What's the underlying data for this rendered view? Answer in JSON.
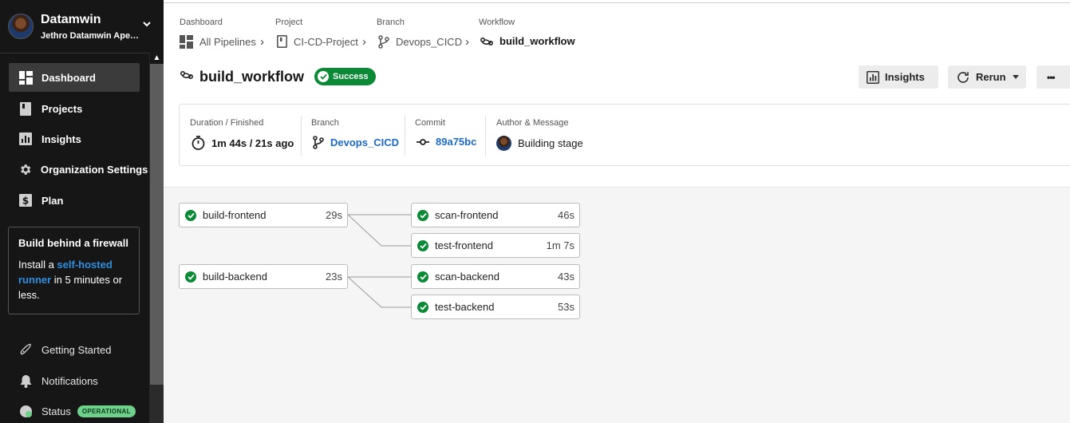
{
  "sidebar": {
    "org_name": "Datamwin",
    "user_name": "Jethro Datamwin Ape…",
    "nav": [
      {
        "label": "Dashboard",
        "icon": "dashboard-icon",
        "active": true
      },
      {
        "label": "Projects",
        "icon": "projects-icon",
        "active": false
      },
      {
        "label": "Insights",
        "icon": "insights-icon",
        "active": false
      },
      {
        "label": "Organization Settings",
        "icon": "gear-icon",
        "active": false
      },
      {
        "label": "Plan",
        "icon": "dollar-icon",
        "active": false
      }
    ],
    "firewall": {
      "title": "Build behind a firewall",
      "text_before": "Install a ",
      "link": "self-hosted runner",
      "text_after": " in 5 minutes or less."
    },
    "bottom": [
      {
        "label": "Getting Started",
        "icon": "rocket-icon"
      },
      {
        "label": "Notifications",
        "icon": "bell-icon"
      },
      {
        "label": "Status",
        "icon": "status-icon",
        "badge": "OPERATIONAL"
      }
    ]
  },
  "breadcrumb": [
    {
      "label": "Dashboard",
      "value": "All Pipelines",
      "icon": "pipelines-icon"
    },
    {
      "label": "Project",
      "value": "CI-CD-Project",
      "icon": "project-icon"
    },
    {
      "label": "Branch",
      "value": "Devops_CICD",
      "icon": "branch-icon"
    },
    {
      "label": "Workflow",
      "value": "build_workflow",
      "icon": "workflow-icon"
    }
  ],
  "header": {
    "title": "build_workflow",
    "status": "Success",
    "insights_label": "Insights",
    "rerun_label": "Rerun",
    "more_label": "•••"
  },
  "info": {
    "duration_label": "Duration / Finished",
    "duration_value": "1m 44s / 21s ago",
    "branch_label": "Branch",
    "branch_value": "Devops_CICD",
    "commit_label": "Commit",
    "commit_value": "89a75bc",
    "author_label": "Author & Message",
    "author_value": "Building stage"
  },
  "jobs": [
    {
      "name": "build-frontend",
      "duration": "29s"
    },
    {
      "name": "scan-frontend",
      "duration": "46s"
    },
    {
      "name": "test-frontend",
      "duration": "1m 7s"
    },
    {
      "name": "build-backend",
      "duration": "23s"
    },
    {
      "name": "scan-backend",
      "duration": "43s"
    },
    {
      "name": "test-backend",
      "duration": "53s"
    }
  ],
  "colors": {
    "sidebar_bg": "#161616",
    "success": "#0b8a36",
    "link": "#1b6ac9",
    "operational": "#6ed08b"
  }
}
